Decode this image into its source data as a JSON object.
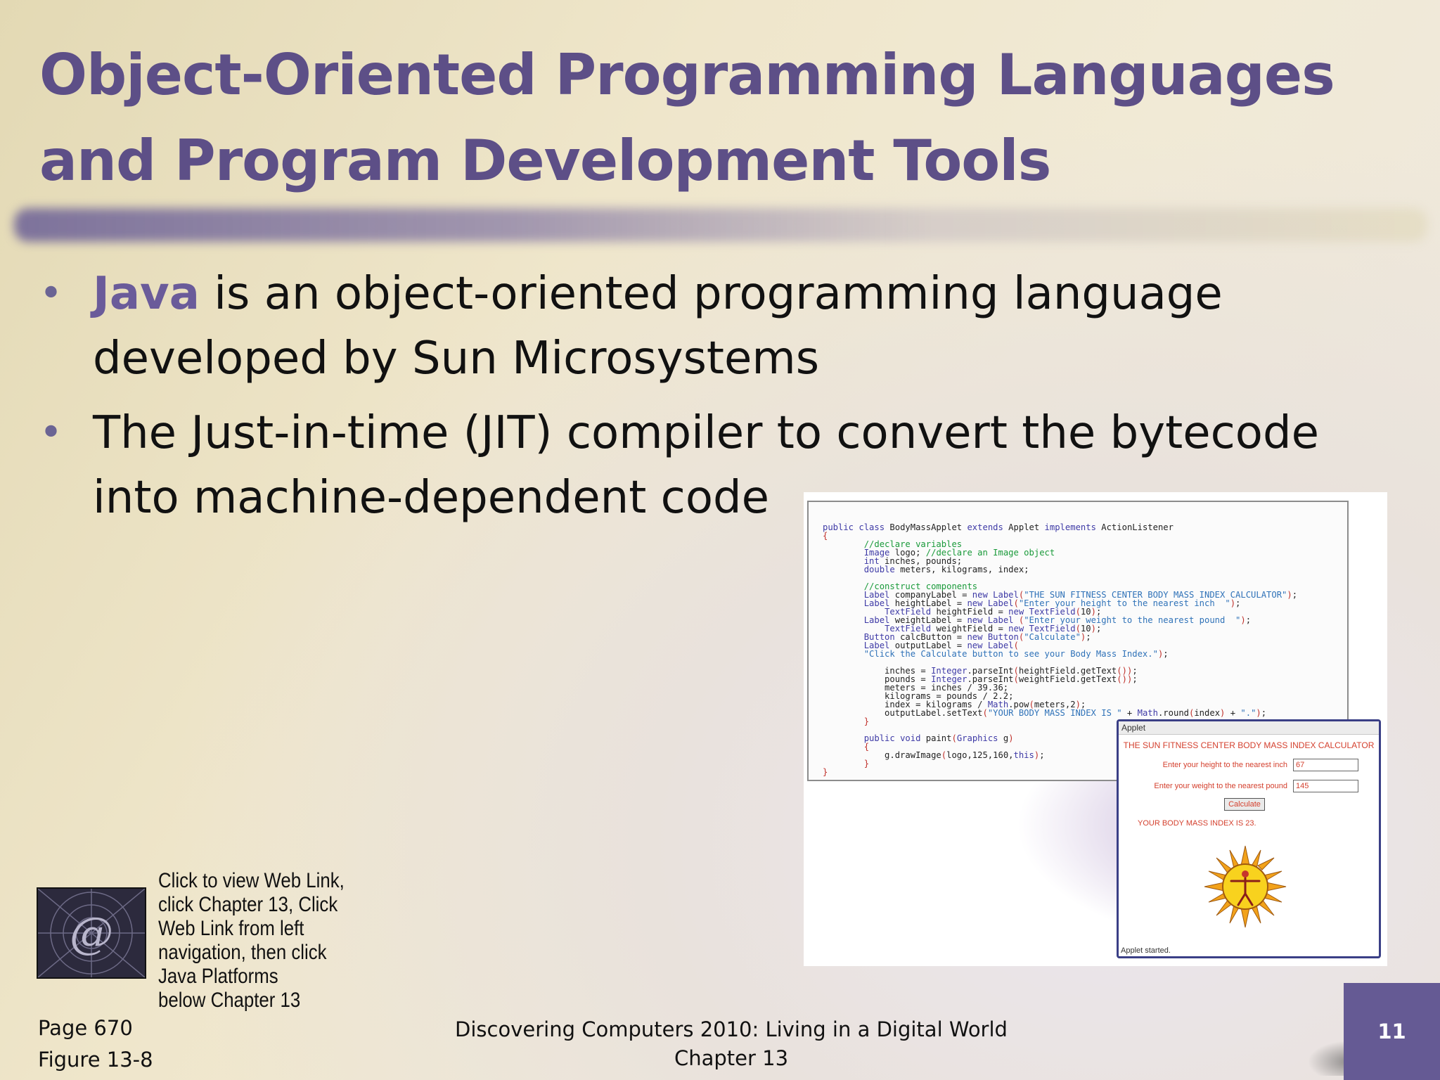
{
  "slide": {
    "title_line1": "Object-Oriented Programming Languages",
    "title_line2": "and Program Development Tools",
    "bullets": [
      {
        "highlight": "Java",
        "text_line1": " is an object-oriented programming language",
        "text_line2": "developed by Sun Microsystems"
      },
      {
        "text_line1": "The Just-in-time (JIT) compiler to convert the bytecode",
        "text_line2": "into machine-dependent code"
      }
    ],
    "bullet_glyph": "•",
    "accent_color": "#5d4f87",
    "highlight_color": "#6a5b9a"
  },
  "figure": {
    "code_lines": [
      "public class BodyMassApplet extends Applet implements ActionListener",
      "{",
      "        //declare variables",
      "        Image logo; //declare an Image object",
      "        int inches, pounds;",
      "        double meters, kilograms, index;",
      "",
      "        //construct components",
      "        Label companyLabel = new Label(\"THE SUN FITNESS CENTER BODY MASS INDEX CALCULATOR\");",
      "        Label heightLabel = new Label(\"Enter your height to the nearest inch  \");",
      "            TextField heightField = new TextField(10);",
      "        Label weightLabel = new Label (\"Enter your weight to the nearest pound  \");",
      "            TextField weightField = new TextField(10);",
      "        Button calcButton = new Button(\"Calculate\");",
      "        Label outputLabel = new Label(",
      "        \"Click the Calculate button to see your Body Mass Index.\");",
      "",
      "            inches = Integer.parseInt(heightField.getText());",
      "            pounds = Integer.parseInt(weightField.getText());",
      "            meters = inches / 39.36;",
      "            kilograms = pounds / 2.2;",
      "            index = kilograms / Math.pow(meters,2);",
      "            outputLabel.setText(\"YOUR BODY MASS INDEX IS \" + Math.round(index) + \".\");",
      "        }",
      "",
      "        public void paint(Graphics g)",
      "        {",
      "            g.drawImage(logo,125,160,this);",
      "        }",
      "}"
    ],
    "applet": {
      "window_title": "Applet",
      "heading": "THE SUN FITNESS CENTER BODY MASS INDEX CALCULATOR",
      "height_label": "Enter your height to the nearest inch",
      "height_value": "67",
      "weight_label": "Enter your weight to the nearest pound",
      "weight_value": "145",
      "button_label": "Calculate",
      "result": "YOUR BODY MASS INDEX IS 23.",
      "status": "Applet started.",
      "logo_icon": "sun-fitness-logo-icon"
    }
  },
  "weblink": {
    "icon": "at-sign-web-icon",
    "lines": [
      "Click to view Web Link,",
      "click Chapter 13, Click",
      "Web Link from left",
      "navigation,  then click",
      "Java Platforms",
      "below Chapter 13"
    ]
  },
  "footer": {
    "page_ref": "Page 670",
    "figure_ref": "Figure 13-8",
    "book_title": "Discovering Computers 2010: Living in a Digital World",
    "chapter": "Chapter 13",
    "slide_number": "11"
  }
}
